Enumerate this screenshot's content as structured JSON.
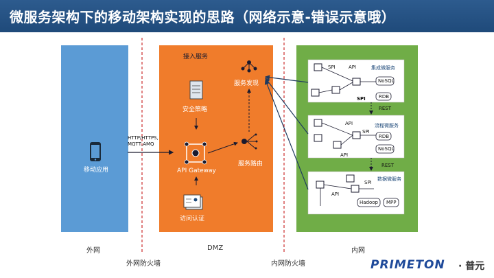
{
  "title": "微服务架构下的移动架构实现的思路（网络示意-错误示意哦）",
  "colors": {
    "title_bg": "#1f4a7a",
    "outer_zone": "#5b9bd5",
    "dmz_zone": "#f07c2b",
    "inner_zone": "#70ad47",
    "firewall_line": "#c00000"
  },
  "zones": {
    "outer": {
      "label": "外网",
      "app_label": "移动应用"
    },
    "dmz": {
      "label": "DMZ",
      "access_title": "接入服务",
      "security": "安全策略",
      "gateway": "API Gateway",
      "auth": "访问认证",
      "discovery": "服务发现",
      "routing": "服务路由"
    },
    "inner": {
      "label": "内网"
    }
  },
  "firewalls": {
    "outer": "外网防火墙",
    "inner": "内网防火墙"
  },
  "protocol_label": "HTTP/HTTPS,\nMQTT,AMQ",
  "services": [
    {
      "title": "集成微服务",
      "dbs": [
        "NoSQL",
        "RDB"
      ]
    },
    {
      "title": "流程微服务",
      "dbs": [
        "RDB",
        "NoSQL"
      ]
    },
    {
      "title": "数据微服务",
      "dbs": [
        "Hadoop",
        "MPP"
      ]
    }
  ],
  "tags": {
    "spi": "SPI",
    "api": "API",
    "rest": "REST"
  },
  "logo": {
    "brand": "PRIMETON",
    "cn": "· 普元"
  },
  "icons": [
    "mobile-phone-icon",
    "scroll-icon",
    "gateway-icon",
    "id-card-icon",
    "network-node-icon",
    "router-icon",
    "cube-icon",
    "database-icon"
  ]
}
